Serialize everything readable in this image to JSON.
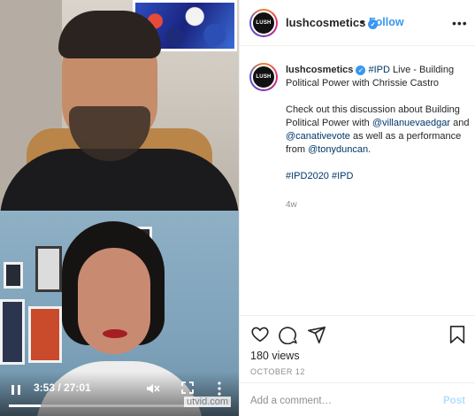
{
  "video": {
    "time": "3:53 / 27:01",
    "progress": 0.144
  },
  "header": {
    "avatar_text": "LUSH",
    "username": "lushcosmetics",
    "verified_mark": "✓",
    "separator": "•",
    "follow_label": "Follow",
    "more_label": "•••"
  },
  "caption": {
    "username": "lushcosmetics",
    "line1_hashtag": "#IPD",
    "line1_rest": " Live - Building Political Power with Chrissie Castro",
    "para2_a": "Check out this discussion about Building Political Power with ",
    "mention1": "@villanuevaedgar",
    "para2_b": " and ",
    "mention2": "@canativevote",
    "para2_c": " as well as a performance from ",
    "mention3": "@tonyduncan",
    "para2_d": ".",
    "hashtag1": "#IPD2020",
    "hashtag2": "#IPD",
    "age": "4w"
  },
  "actions": {
    "views": "180 views",
    "date": "OCTOBER 12"
  },
  "comment": {
    "placeholder": "Add a comment…",
    "post_label": "Post"
  },
  "watermark": "utvid.com",
  "colors": {
    "link": "#00376b",
    "follow": "#3897f0",
    "muted": "#8e8e8e"
  }
}
